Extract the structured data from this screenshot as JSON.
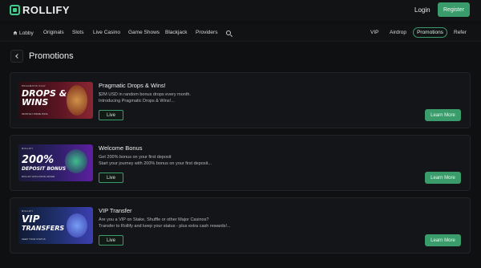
{
  "app": {
    "name": "ROLLIFY"
  },
  "header": {
    "login": "Login",
    "register": "Register"
  },
  "nav": {
    "left": [
      "Lobby",
      "Originals",
      "Slots",
      "Live Casino",
      "Game Shows",
      "Blackjack",
      "Providers"
    ],
    "right": [
      "VIP",
      "Airdrop",
      "Promotions",
      "Refer"
    ],
    "active": "Promotions"
  },
  "page": {
    "title": "Promotions"
  },
  "colors": {
    "accent": "#3a9c6b",
    "background": "#0f1012",
    "card": "#141518"
  },
  "promotions": [
    {
      "title": "Pragmatic Drops & Wins!",
      "lines": [
        "$2M USD in random bonus drops every month.",
        "Introducing Pragmatic Drops & Wins!..."
      ],
      "status": "Live",
      "action": "Learn More",
      "banner": {
        "tag": "PRAGMATIC PLAY",
        "headline": [
          "DROPS &",
          "WINS"
        ],
        "sub": "MONTHLY PRIZE POOL"
      }
    },
    {
      "title": "Welcome Bonus",
      "lines": [
        "Get 200% bonus on your first deposit",
        "Start your journey with 200% bonus on your first deposit..."
      ],
      "status": "Live",
      "action": "Learn More",
      "banner": {
        "tag": "ROLLIFY",
        "headline": [
          "200%",
          "DEPOSIT BONUS"
        ],
        "sub": "ROLLIFY EXCLUSIVE OFFER"
      }
    },
    {
      "title": "VIP Transfer",
      "lines": [
        "Are you a VIP on Stake, Shuffle or other Major Casinos?",
        "Transfer to Rollify and keep your status - plus extra cash rewards!..."
      ],
      "status": "Live",
      "action": "Learn More",
      "banner": {
        "tag": "ROLLIFY",
        "headline": [
          "VIP",
          "TRANSFERS"
        ],
        "sub": "KEEP YOUR STATUS"
      }
    }
  ]
}
